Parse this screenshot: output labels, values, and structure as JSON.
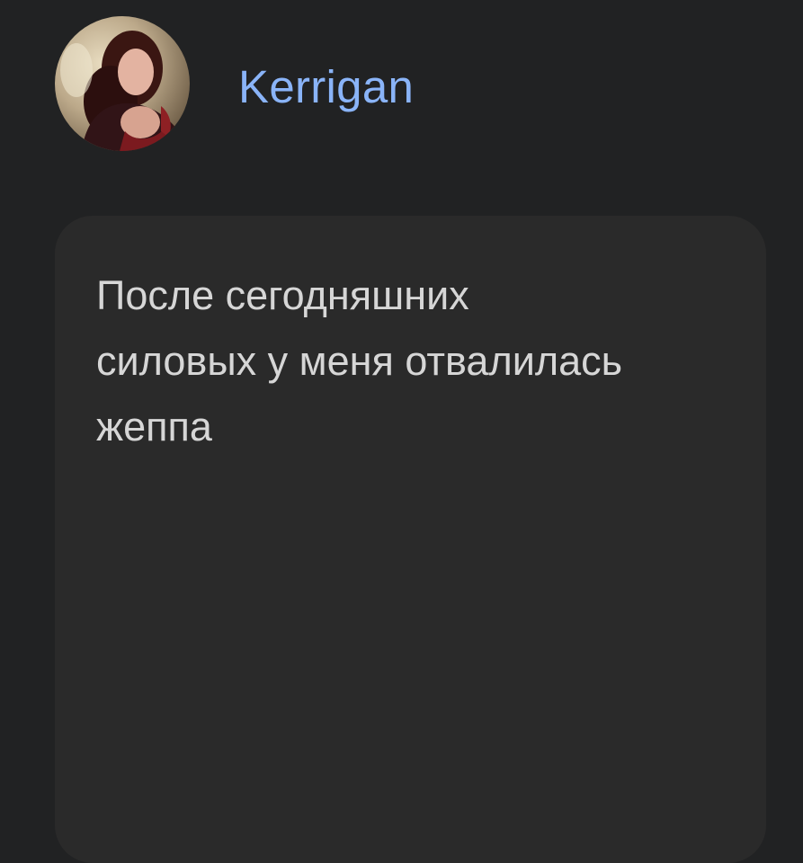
{
  "header": {
    "author_name": "Kerrigan",
    "avatar_icon": "user-avatar-photo"
  },
  "post": {
    "text": "После сегодняшних\nсиловых у меня отвалилась\nжеппа"
  },
  "colors": {
    "background": "#212223",
    "card": "#2a2a2a",
    "author_name": "#8ab4f8",
    "text": "#d6d6d6"
  }
}
